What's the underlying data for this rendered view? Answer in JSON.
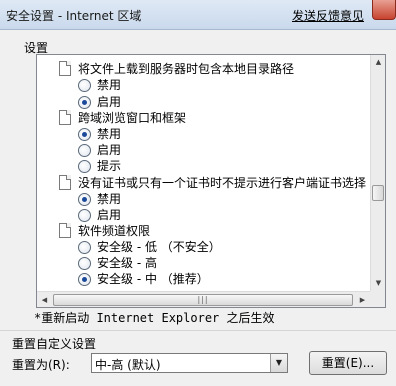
{
  "window": {
    "title": "安全设置 - Internet 区域",
    "feedback_link": "发送反馈意见"
  },
  "settings_label": "设置",
  "list_rows": [
    {
      "kind": "header",
      "text": "将文件上载到服务器时包含本地目录路径"
    },
    {
      "kind": "option",
      "text": "禁用",
      "checked": false
    },
    {
      "kind": "option",
      "text": "启用",
      "checked": true
    },
    {
      "kind": "header",
      "text": "跨域浏览窗口和框架"
    },
    {
      "kind": "option",
      "text": "禁用",
      "checked": true
    },
    {
      "kind": "option",
      "text": "启用",
      "checked": false
    },
    {
      "kind": "option",
      "text": "提示",
      "checked": false
    },
    {
      "kind": "header",
      "text": "没有证书或只有一个证书时不提示进行客户端证书选择"
    },
    {
      "kind": "option",
      "text": "禁用",
      "checked": true
    },
    {
      "kind": "option",
      "text": "启用",
      "checked": false
    },
    {
      "kind": "header",
      "text": "软件频道权限"
    },
    {
      "kind": "option",
      "text": "安全级 - 低 （不安全）",
      "checked": false
    },
    {
      "kind": "option",
      "text": "安全级 - 高",
      "checked": false
    },
    {
      "kind": "option",
      "text": "安全级 - 中 （推荐）",
      "checked": true
    }
  ],
  "restart_note": "*重新启动 Internet Explorer 之后生效",
  "reset_section": {
    "group_label": "重置自定义设置",
    "reset_to_label": "重置为(R):",
    "selected_level": "中-高 (默认)",
    "reset_button": "重置(E)..."
  },
  "icons": {
    "close": "close-icon",
    "scroll_up": "arrow-up-icon",
    "scroll_down": "arrow-down-icon",
    "scroll_left": "arrow-left-icon",
    "scroll_right": "arrow-right-icon",
    "dropdown": "chevron-down-icon",
    "setting_doc": "document-icon"
  }
}
